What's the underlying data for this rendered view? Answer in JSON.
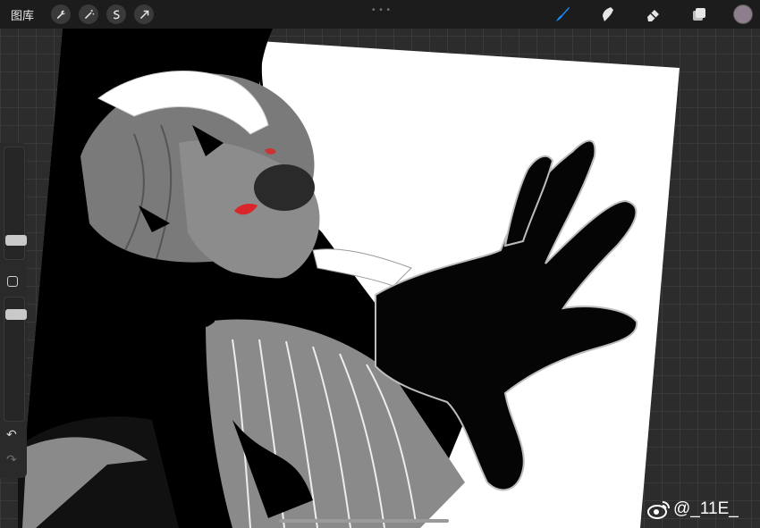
{
  "topbar": {
    "gallery_label": "图库",
    "tools_left": [
      "wrench-icon",
      "magic-wand-icon",
      "selection-icon",
      "transform-arrow-icon"
    ],
    "tools_right": [
      "brush-icon",
      "smudge-icon",
      "eraser-icon",
      "layers-icon"
    ],
    "current_color": "#8f7f8e",
    "active_tool_color": "#1a8cff"
  },
  "sidebar": {
    "undo_symbol": "↶",
    "redo_symbol": "↷",
    "brush_size": 0.15,
    "opacity": 0.85
  },
  "watermark": {
    "handle": "@_11E_"
  }
}
